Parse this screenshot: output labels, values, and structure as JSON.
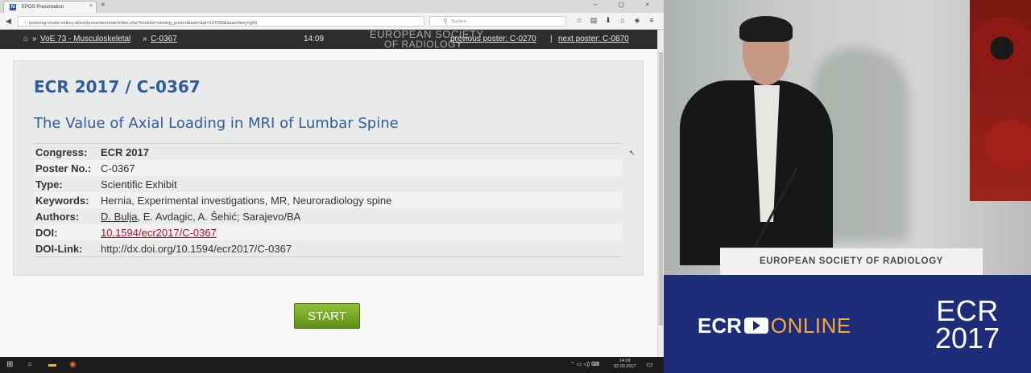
{
  "browser": {
    "tab_title": "EPOS Presentation",
    "url": "posterng-onsite.netkey.at/esr/presentermode/index.php?module=viewing_poster&task=&pi=137095&searchkey=g90",
    "search_placeholder": "Suchen",
    "new_tab_glyph": "+",
    "tab_close_glyph": "×",
    "window_controls": "– ▢ ×",
    "icons": [
      "back-icon",
      "info-icon",
      "bookmark-star-icon",
      "library-icon",
      "download-icon",
      "home-icon",
      "pocket-icon",
      "menu-icon"
    ]
  },
  "posterbar": {
    "home_glyph": "⌂",
    "crumb_sep": "»",
    "crumb_1": "VoE 73 - Musculoskeletal",
    "crumb_2": "C-0367",
    "time": "14:09",
    "prev_label": "previous poster: C-0270",
    "separator": "|",
    "next_label": "next poster: C-0870",
    "logo_line1": "EUROPEAN SOCIETY",
    "logo_line2": "OF RADIOLOGY"
  },
  "poster": {
    "id_heading": "ECR 2017 / C-0367",
    "title": "The Value of Axial Loading in MRI of Lumbar Spine",
    "meta": {
      "congress_key": "Congress:",
      "congress_val": "ECR 2017",
      "posterno_key": "Poster No.:",
      "posterno_val": "C-0367",
      "type_key": "Type:",
      "type_val": "Scientific Exhibit",
      "keywords_key": "Keywords:",
      "keywords_val": "Hernia, Experimental investigations, MR, Neuroradiology spine",
      "authors_key": "Authors:",
      "author_main": "D. Bulja",
      "authors_rest": ", E. Avdagic, A. Šehić; Sarajevo/BA",
      "doi_key": "DOI:",
      "doi_val": "10.1594/ecr2017/C-0367",
      "doilink_key": "DOI-Link:",
      "doilink_val": "http://dx.doi.org/10.1594/ecr2017/C-0367"
    },
    "start_label": "START"
  },
  "taskbar": {
    "clock_time": "14:09",
    "clock_date": "02.03.2017",
    "icons": [
      "windows-start-icon",
      "search-icon",
      "file-explorer-icon",
      "firefox-icon",
      "tray-chevron-icon",
      "network-icon",
      "volume-icon",
      "keyboard-icon",
      "notification-icon"
    ]
  },
  "video": {
    "lectern_text": "EUROPEAN SOCIETY OF RADIOLOGY"
  },
  "banner": {
    "ecr_text": "ECR",
    "online_text": "ONLINE",
    "logo_top": "ECR",
    "logo_bottom": "2017",
    "colors": {
      "background": "#1d2d79",
      "accent": "#f4a93b"
    }
  }
}
